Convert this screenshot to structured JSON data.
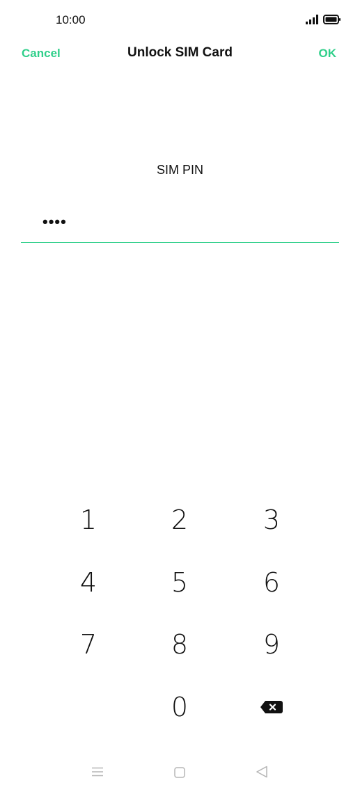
{
  "status_bar": {
    "time": "10:00"
  },
  "header": {
    "cancel_label": "Cancel",
    "title": "Unlock SIM Card",
    "ok_label": "OK"
  },
  "pin": {
    "label": "SIM PIN",
    "value": "••••"
  },
  "keypad": {
    "keys": [
      "1",
      "2",
      "3",
      "4",
      "5",
      "6",
      "7",
      "8",
      "9",
      "0"
    ],
    "backspace_icon": "backspace-icon"
  },
  "nav_bar": {
    "icons": [
      "menu-icon",
      "home-icon",
      "back-icon"
    ]
  },
  "colors": {
    "accent": "#2fcf8a",
    "text": "#111111",
    "background": "#ffffff",
    "nav_icon": "#b5b5b5"
  }
}
